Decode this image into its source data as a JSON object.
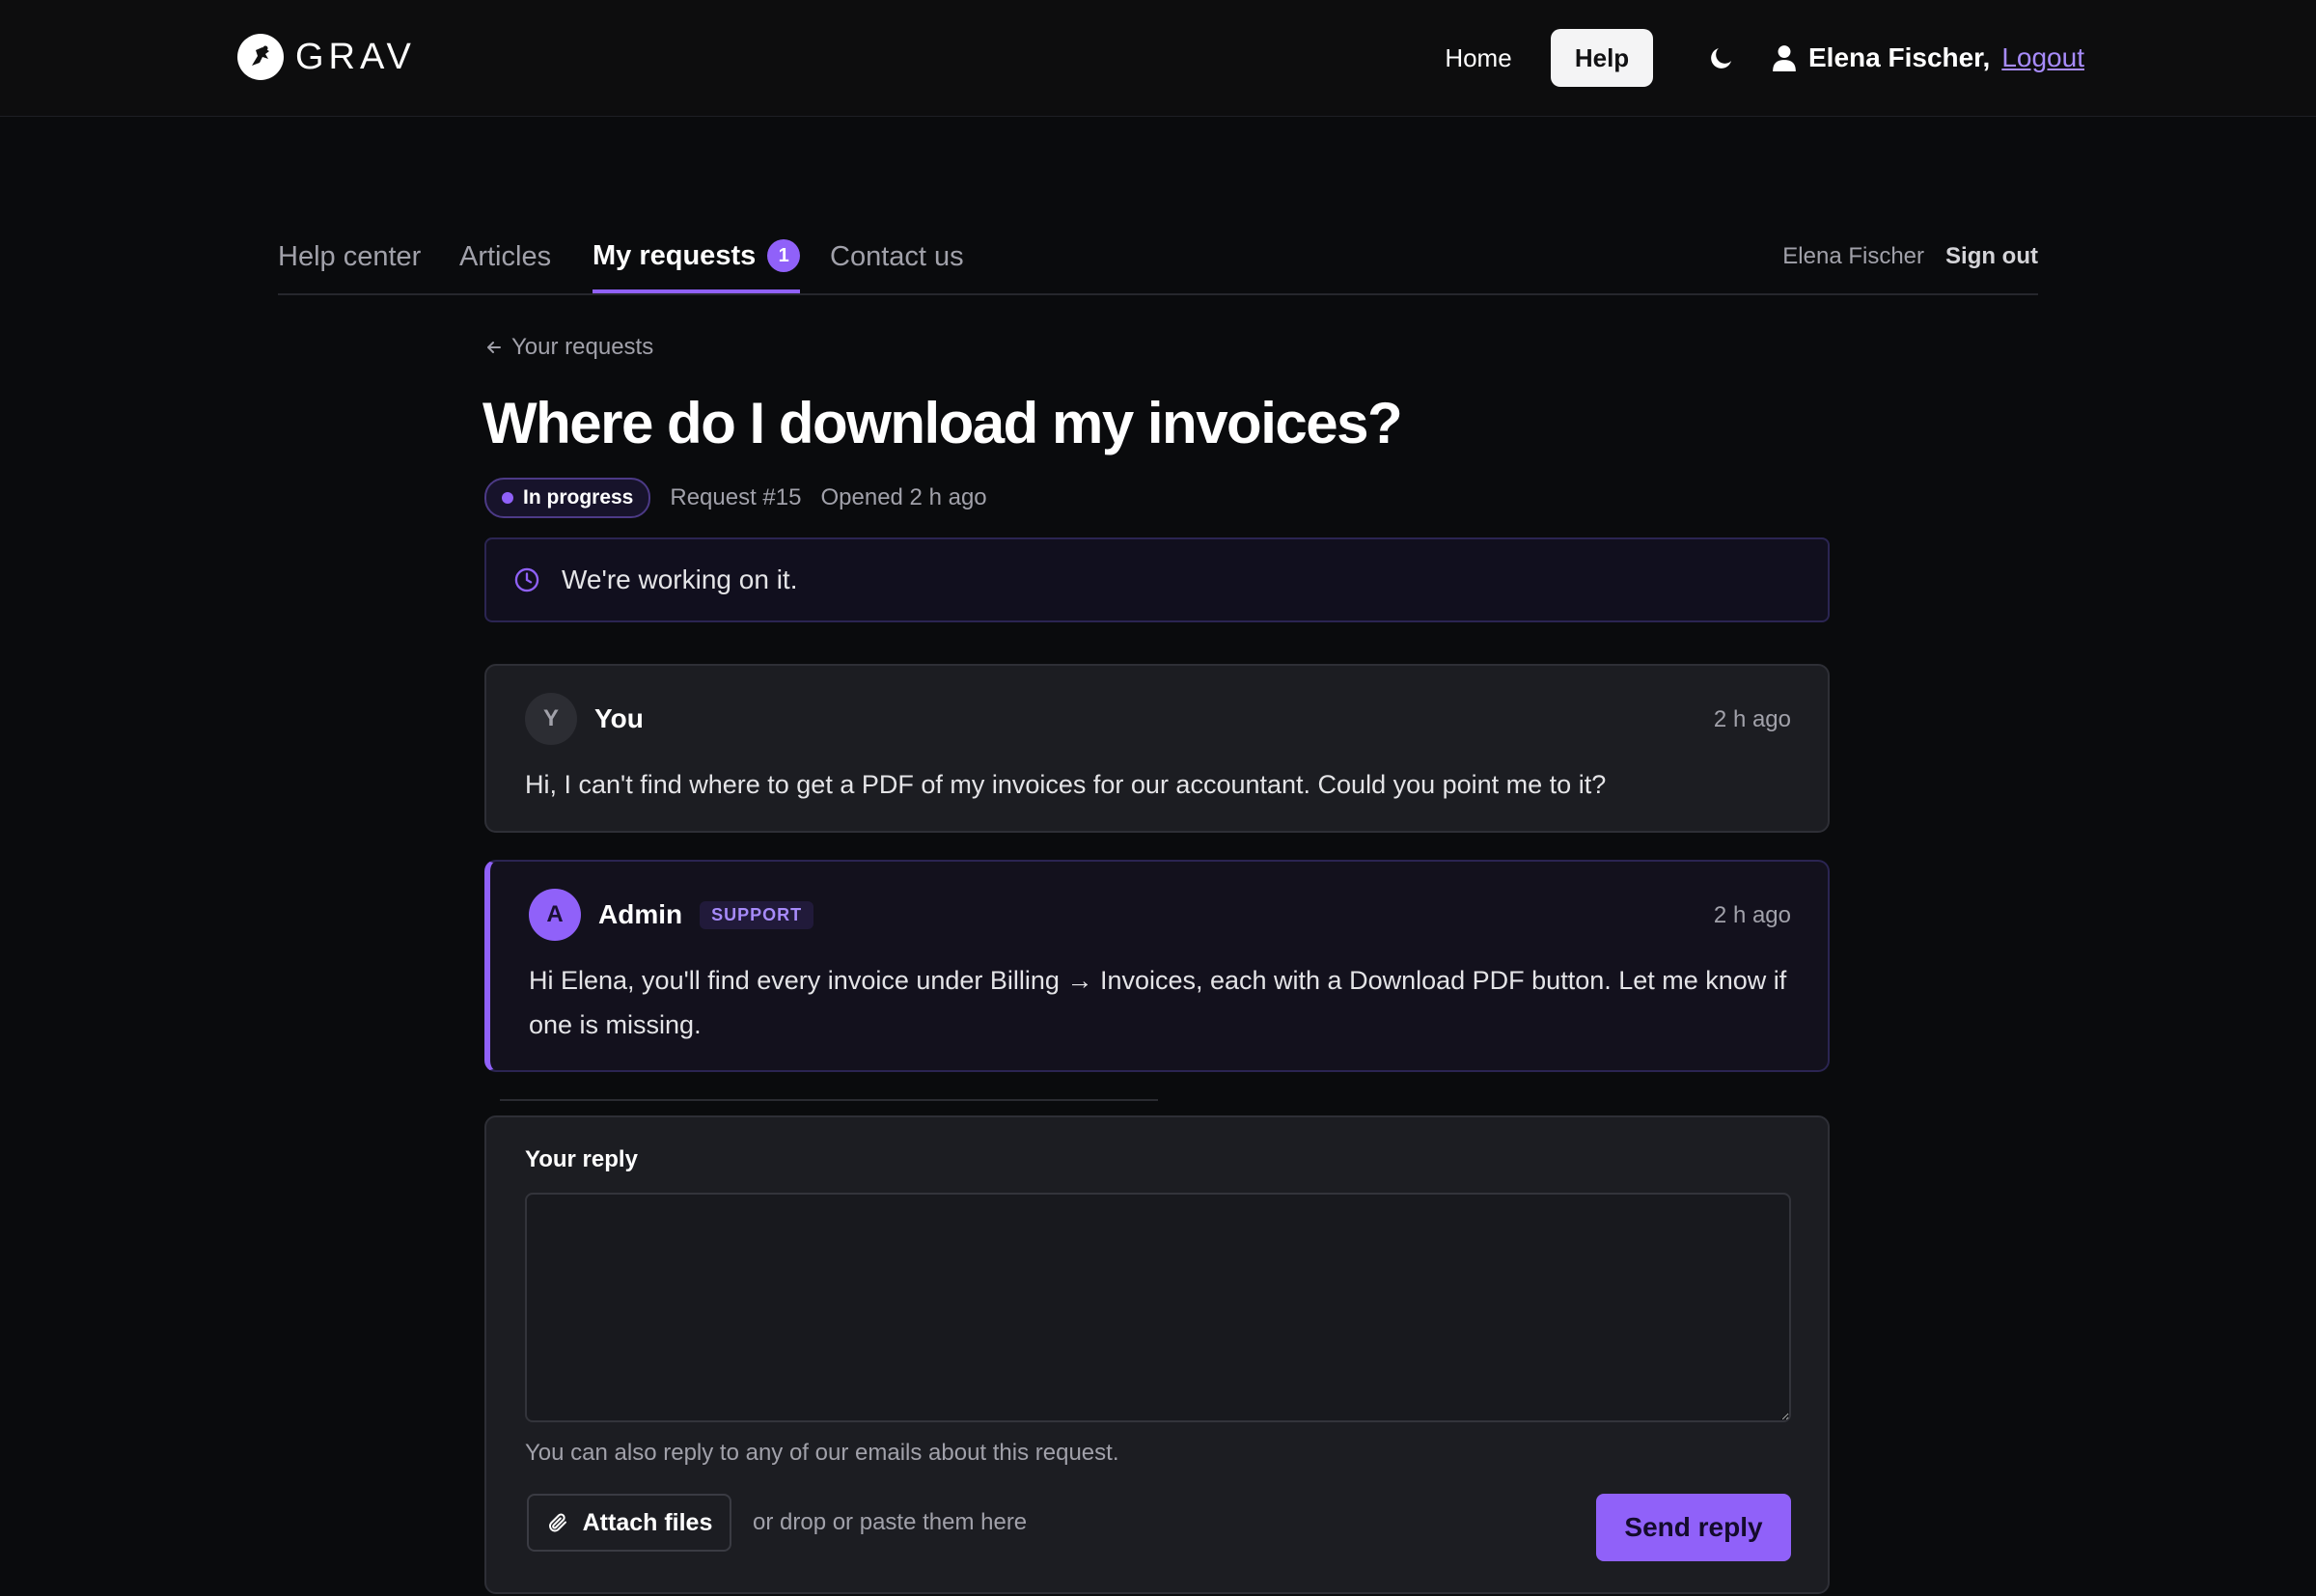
{
  "topbar": {
    "logo_text": "GRAV",
    "nav_home": "Home",
    "nav_help": "Help",
    "user_name": "Elena Fischer,",
    "logout_label": "Logout"
  },
  "help_nav": {
    "tabs": [
      {
        "label": "Help center"
      },
      {
        "label": "Articles"
      },
      {
        "label": "My requests",
        "badge": "1"
      },
      {
        "label": "Contact us"
      }
    ],
    "user_name": "Elena Fischer",
    "signout_label": "Sign out"
  },
  "request": {
    "back_label": "Your requests",
    "title": "Where do I download my invoices?",
    "status": "In progress",
    "request_number": "Request #15",
    "opened": "Opened 2 h ago",
    "status_message": "We're working on it."
  },
  "messages": [
    {
      "avatar": "Y",
      "author": "You",
      "time": "2 h ago",
      "body": "Hi, I can't find where to get a PDF of my invoices for our accountant. Could you point me to it?"
    },
    {
      "avatar": "A",
      "author": "Admin",
      "tag": "SUPPORT",
      "time": "2 h ago",
      "body": "Hi Elena, you'll find every invoice under Billing → Invoices, each with a Download PDF button. Let me know if one is missing."
    }
  ],
  "reply": {
    "label": "Your reply",
    "value": "",
    "hint": "You can also reply to any of our emails about this request.",
    "attach_label": "Attach files",
    "drop_hint": "or drop or paste them here",
    "send_label": "Send reply"
  },
  "colors": {
    "background": "#0a0b0d",
    "accent": "#9061f9",
    "link": "#a78bfa",
    "card": "#1c1d22"
  }
}
